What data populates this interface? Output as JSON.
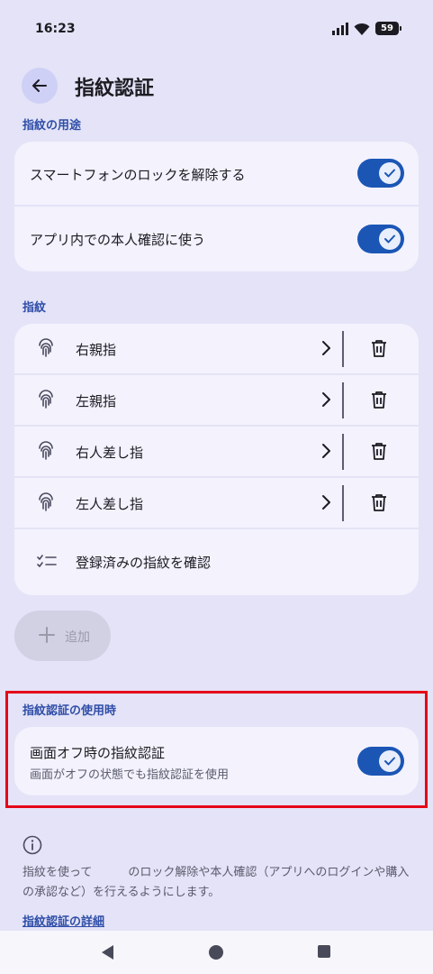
{
  "status_bar": {
    "time": "16:23",
    "battery": "59"
  },
  "header": {
    "title": "指紋認証",
    "back_icon": "arrow-left-icon"
  },
  "usage_section": {
    "label": "指紋の用途",
    "items": [
      {
        "label": "スマートフォンのロックを解除する",
        "enabled": true
      },
      {
        "label": "アプリ内での本人確認に使う",
        "enabled": true
      }
    ]
  },
  "fingerprint_section": {
    "label": "指紋",
    "fingerprints": [
      {
        "name": "右親指"
      },
      {
        "name": "左親指"
      },
      {
        "name": "右人差し指"
      },
      {
        "name": "左人差し指"
      }
    ],
    "check_registered_label": "登録済みの指紋を確認",
    "add_label": "追加"
  },
  "screen_off_section": {
    "label": "指紋認証の使用時",
    "title": "画面オフ時の指紋認証",
    "subtitle": "画面がオフの状態でも指紋認証を使用",
    "enabled": true
  },
  "info": {
    "text_part1": "指紋を使って",
    "text_part2": "のロック解除や本人確認（アプリへのログインや購入の承認など）を行えるようにします。",
    "link": "指紋認証の詳細"
  },
  "colors": {
    "background": "#e4e3f7",
    "card": "#f3f2fd",
    "accent": "#1b56b5",
    "section_label": "#2f4ea8",
    "highlight": "#e5051a"
  }
}
